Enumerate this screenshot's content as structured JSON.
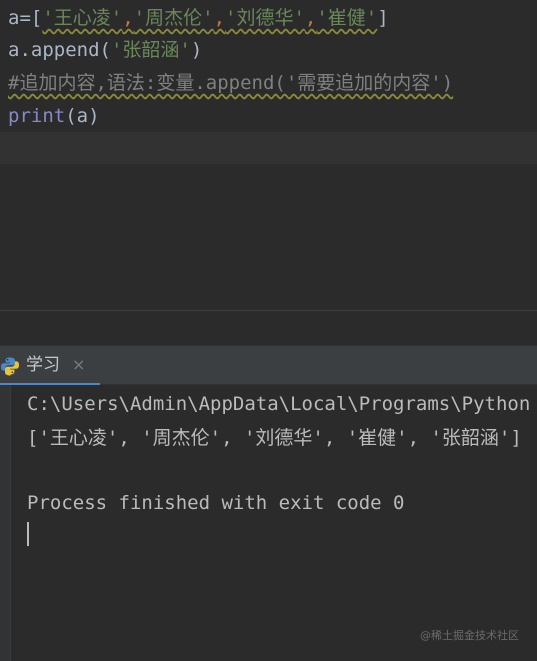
{
  "editor": {
    "lines": [
      {
        "t1": "a=[",
        "s1": "'王心凌'",
        "s2": "'周杰伦'",
        "s3": "'刘德华'",
        "s4": "'崔健'",
        "comma": ",",
        "close": "]"
      },
      {
        "pre": "a.append(",
        "str": "'张韶涵'",
        "post": ")"
      },
      {
        "comment": "#追加内容,语法:变量.append('需要追加的内容')"
      },
      {
        "kw": "print",
        "rest": "(a)"
      }
    ]
  },
  "run_panel": {
    "tab_label": "学习",
    "tab_close": "×",
    "icon": "python-icon",
    "accent": "#4a88c7"
  },
  "console": {
    "lines": [
      "C:\\Users\\Admin\\AppData\\Local\\Programs\\Python",
      "['王心凌', '周杰伦', '刘德华', '崔健', '张韶涵']",
      "Process finished with exit code 0"
    ]
  },
  "watermark": "@稀土掘金技术社区"
}
